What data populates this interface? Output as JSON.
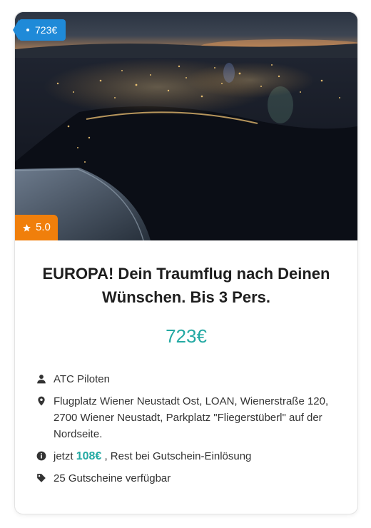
{
  "card": {
    "price_tag": "723€",
    "rating": "5.0",
    "title": "EUROPA! Dein Traumflug nach Deinen Wünschen. Bis 3 Pers.",
    "price": "723€",
    "provider": "ATC Piloten",
    "location": "Flugplatz Wiener Neustadt Ost, LOAN, Wienerstraße 120, 2700 Wiener Neustadt, Parkplatz \"Fliegerstüberl\" auf der Nordseite.",
    "payment_prefix": "jetzt",
    "payment_amount": "108€",
    "payment_suffix": ", Rest bei Gutschein-Einlösung",
    "availability": "25 Gutscheine verfügbar"
  },
  "icons": {
    "rating": "star-icon",
    "provider": "user-icon",
    "location": "map-pin-icon",
    "payment": "info-circle-icon",
    "availability": "tag-icon"
  },
  "colors": {
    "price_tag": "#1f8ad8",
    "rating_badge": "#f07f0b",
    "accent": "#23a9a3"
  }
}
